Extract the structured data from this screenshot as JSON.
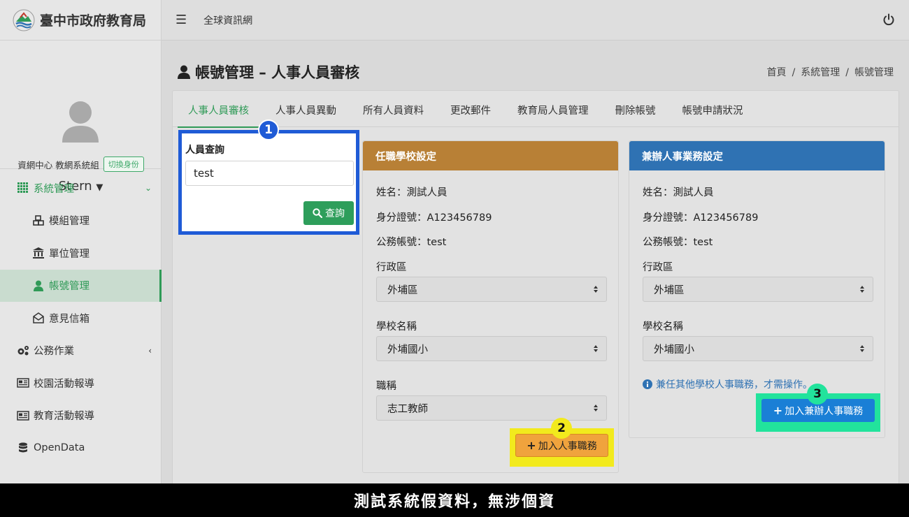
{
  "brand": {
    "title": "臺中市政府教育局"
  },
  "user": {
    "org": "資網中心 教網系統組",
    "switch_label": "切換身份",
    "name": "Stern"
  },
  "sidebar": {
    "items": [
      {
        "label": "系統管理",
        "icon": "grid-icon"
      },
      {
        "label": "模組管理",
        "icon": "cubes-icon"
      },
      {
        "label": "單位管理",
        "icon": "institution-icon"
      },
      {
        "label": "帳號管理",
        "icon": "user-icon"
      },
      {
        "label": "意見信箱",
        "icon": "envelope-open-icon"
      },
      {
        "label": "公務作業",
        "icon": "cogs-icon"
      },
      {
        "label": "校園活動報導",
        "icon": "newspaper-icon"
      },
      {
        "label": "教育活動報導",
        "icon": "newspaper-icon"
      },
      {
        "label": "OpenData",
        "icon": "database-icon"
      }
    ]
  },
  "topbar": {
    "link": "全球資訊網"
  },
  "page": {
    "title": "帳號管理 – 人事人員審核"
  },
  "breadcrumb": {
    "home": "首頁",
    "level2": "系統管理",
    "current": "帳號管理"
  },
  "tabs": [
    "人事人員審核",
    "人事人員異動",
    "所有人員資料",
    "更改郵件",
    "教育局人員管理",
    "刪除帳號",
    "帳號申請狀況"
  ],
  "search": {
    "label": "人員查詢",
    "value": "test",
    "button": "查詢"
  },
  "left_panel": {
    "title": "任職學校設定",
    "name_line": "姓名：測試人員",
    "id_line": "身分證號：A123456789",
    "account_line": "公務帳號：test",
    "district_label": "行政區",
    "district_value": "外埔區",
    "school_label": "學校名稱",
    "school_value": "外埔國小",
    "title_label": "職稱",
    "title_value": "志工教師",
    "add_button": "加入人事職務"
  },
  "right_panel": {
    "title": "兼辦人事業務設定",
    "name_line": "姓名：測試人員",
    "id_line": "身分證號：A123456789",
    "account_line": "公務帳號：test",
    "district_label": "行政區",
    "district_value": "外埔區",
    "school_label": "學校名稱",
    "school_value": "外埔國小",
    "hint": "兼任其他學校人事職務，才需操作。",
    "add_button": "加入兼辦人事職務"
  },
  "steps": [
    "1",
    "2",
    "3"
  ],
  "caption": "測試系統假資料，無涉個資",
  "colors": {
    "accent_green": "#2f9a57",
    "step1_blue": "#1f5bd6",
    "step2_yellow": "#f2ea1d",
    "step3_green": "#22e39c",
    "orange_panel": "#b88036",
    "blue_panel": "#2f72b3"
  }
}
